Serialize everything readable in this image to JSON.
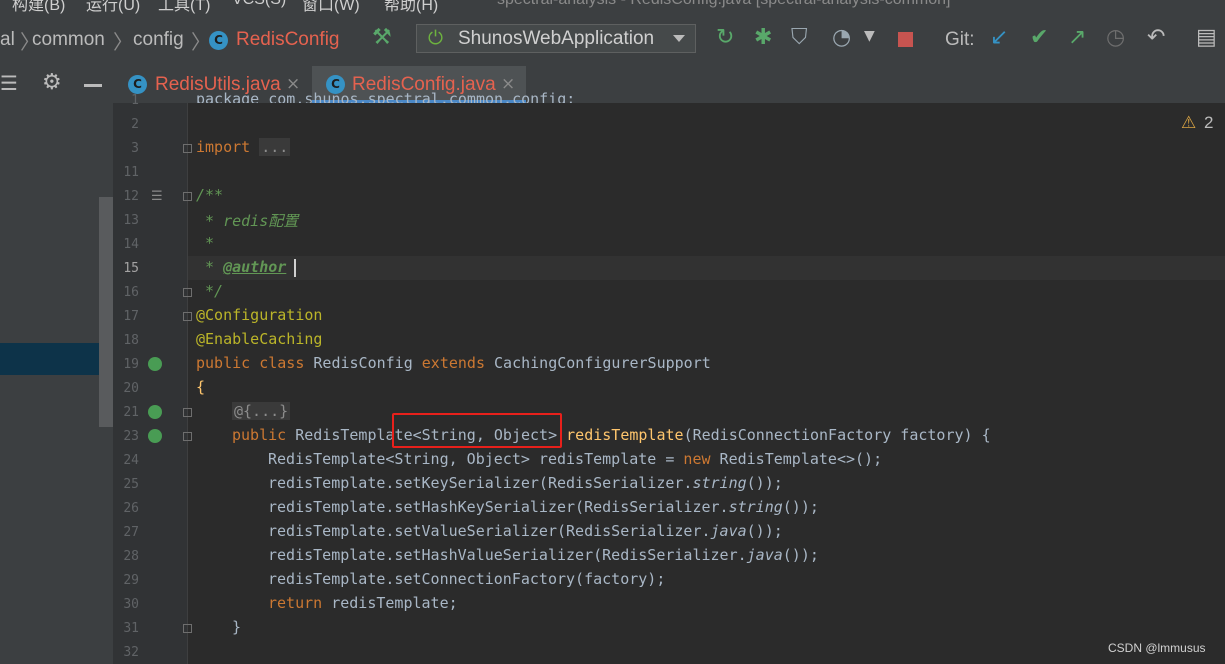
{
  "menubar": {
    "items": [
      "构建(B)",
      "运行(U)",
      "工具(T)",
      "VCS(S)",
      "窗口(W)",
      "帮助(H)"
    ],
    "window_title": "spectral-analysis - RedisConfig.java [spectral-analysis-common]"
  },
  "breadcrumb": {
    "items": [
      "al",
      "common",
      "config",
      "RedisConfig"
    ]
  },
  "run_config": {
    "label": "ShunosWebApplication"
  },
  "git": {
    "label": "Git:"
  },
  "tabs": [
    {
      "label": "RedisUtils.java",
      "close": "×",
      "selected": false
    },
    {
      "label": "RedisConfig.java",
      "close": "×",
      "selected": true
    }
  ],
  "editor": {
    "line_numbers": [
      "1",
      "2",
      "3",
      "11",
      "12",
      "13",
      "14",
      "15",
      "16",
      "17",
      "18",
      "19",
      "20",
      "21",
      "23",
      "24",
      "25",
      "26",
      "27",
      "28",
      "29",
      "30",
      "31",
      "32"
    ],
    "current_line": "15",
    "warnings": {
      "count": "2"
    },
    "lines": {
      "l1": "package com.shunos.spectral.common.config;",
      "l3_kw": "import",
      "l3_fold": "...",
      "l12": "/**",
      "l13": " * redis配置",
      "l14": " *",
      "l15_pre": " * ",
      "l15_tag": "@author",
      "l16": " */",
      "l17": "@Configuration",
      "l18": "@EnableCaching",
      "l19_kw1": "public class",
      "l19_name": " RedisConfig ",
      "l19_kw2": "extends",
      "l19_sup": " CachingConfigurerSupport",
      "l20": "{",
      "l21": "@{...}",
      "l23_kw": "public",
      "l23_type": " RedisTemplate<String, Object> ",
      "l23_mt": "redisTemplate",
      "l23_params": "(RedisConnectionFactory factory) {",
      "l24_a": "RedisTemplate<String, Object> redisTemplate = ",
      "l24_kw": "new",
      "l24_b": " RedisTemplate<>();",
      "l25_a": "redisTemplate.setKeySerializer(RedisSerializer.",
      "l25_it": "string",
      "l25_b": "());",
      "l26_a": "redisTemplate.setHashKeySerializer(RedisSerializer.",
      "l26_it": "string",
      "l26_b": "());",
      "l27_a": "redisTemplate.setValueSerializer(RedisSerializer.",
      "l27_it": "java",
      "l27_b": "());",
      "l28_a": "redisTemplate.setHashValueSerializer(RedisSerializer.",
      "l28_it": "java",
      "l28_b": "());",
      "l29": "redisTemplate.setConnectionFactory(factory);",
      "l30_kw": "return",
      "l30_b": " redisTemplate;",
      "l31": "}"
    }
  },
  "watermark": "CSDN @lmmusus",
  "colors": {
    "accent": "#e5624f",
    "highlight_box": "#e8201b",
    "keyword": "#cc7832",
    "annotation": "#bbb529",
    "comment": "#629755"
  },
  "icons": [
    "build-hammer-icon",
    "spring-boot-icon",
    "rerun-icon",
    "debug-bug-icon",
    "coverage-icon",
    "profiler-icon",
    "stop-icon",
    "git-update-icon",
    "git-commit-icon",
    "git-push-icon",
    "history-icon",
    "rollback-icon",
    "project-structure-icon",
    "settings-gear-icon",
    "minimize-icon",
    "class-icon",
    "warning-icon"
  ]
}
